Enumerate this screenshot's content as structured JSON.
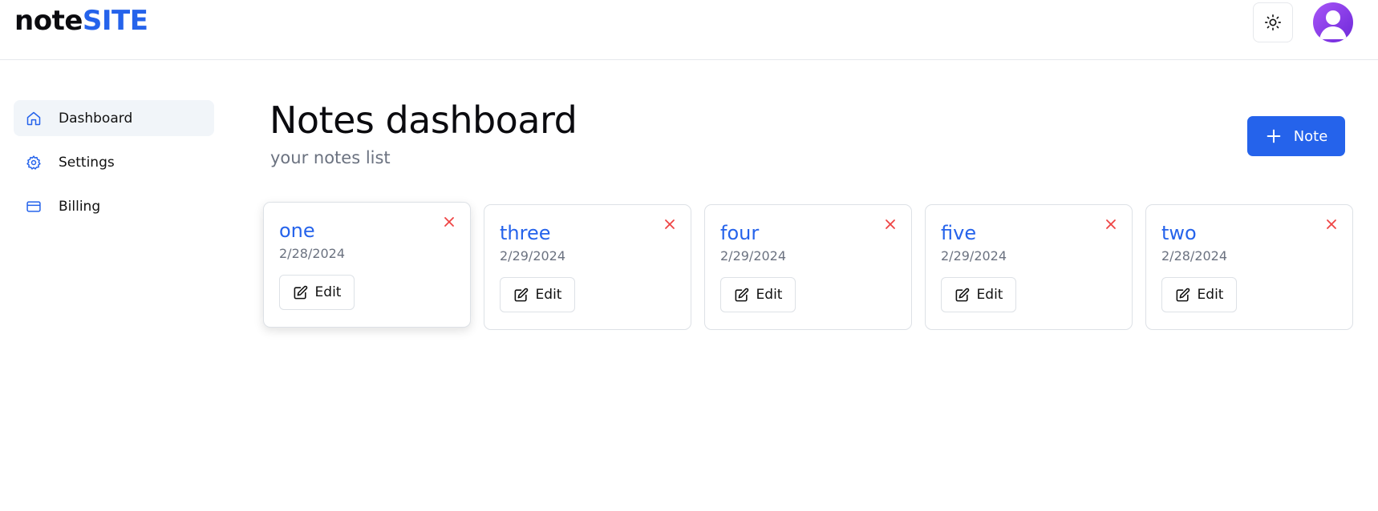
{
  "header": {
    "logo_prefix": "note",
    "logo_accent": "SITE",
    "theme_icon": "sun-icon",
    "avatar_icon": "user-avatar"
  },
  "sidebar": {
    "items": [
      {
        "label": "Dashboard",
        "icon": "home-icon",
        "active": true
      },
      {
        "label": "Settings",
        "icon": "gear-icon",
        "active": false
      },
      {
        "label": "Billing",
        "icon": "credit-card-icon",
        "active": false
      }
    ]
  },
  "main": {
    "title": "Notes dashboard",
    "subtitle": "your notes list",
    "add_button_label": "Note",
    "notes": [
      {
        "title": "one",
        "date": "2/28/2024",
        "edit_label": "Edit"
      },
      {
        "title": "three",
        "date": "2/29/2024",
        "edit_label": "Edit"
      },
      {
        "title": "four",
        "date": "2/29/2024",
        "edit_label": "Edit"
      },
      {
        "title": "five",
        "date": "2/29/2024",
        "edit_label": "Edit"
      },
      {
        "title": "two",
        "date": "2/28/2024",
        "edit_label": "Edit"
      }
    ]
  },
  "colors": {
    "accent": "#2563eb",
    "delete": "#ef4444",
    "muted_text": "#6b7280",
    "active_bg": "#f1f5f9"
  }
}
